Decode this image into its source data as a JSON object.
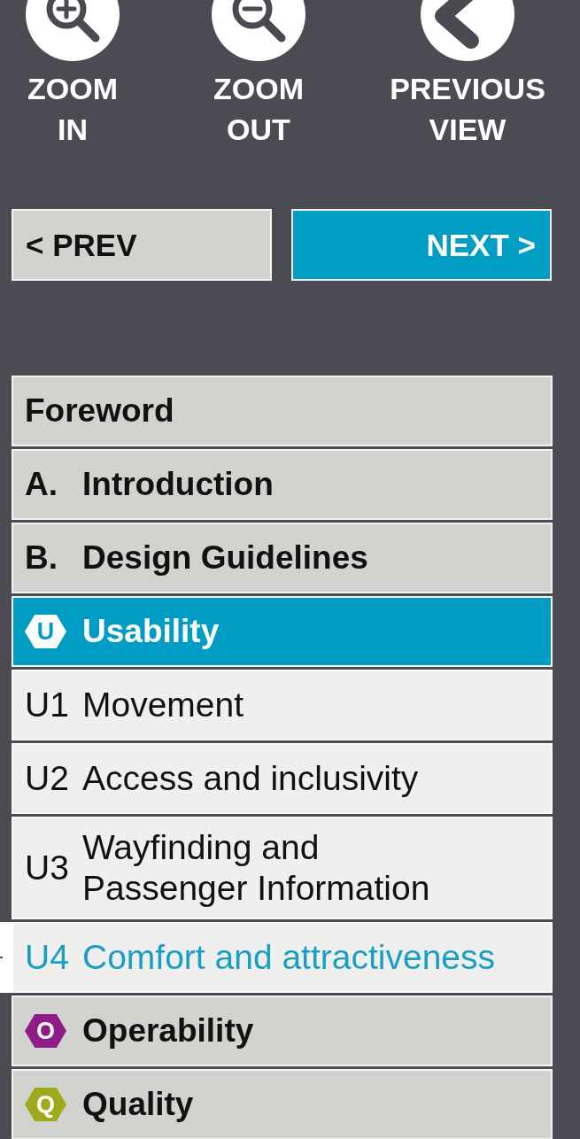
{
  "toolbar": [
    {
      "kind": "zoom_in",
      "label": "ZOOM IN"
    },
    {
      "kind": "zoom_out",
      "label": "ZOOM OUT"
    },
    {
      "kind": "previous_view",
      "label": "PREVIOUS VIEW"
    }
  ],
  "pager": [
    {
      "kind": "prev",
      "label": "< PREV"
    },
    {
      "kind": "next",
      "label": "NEXT >"
    }
  ],
  "nav": [
    {
      "kind": "section",
      "title": "Foreword"
    },
    {
      "kind": "section",
      "number": "A.",
      "title": "Introduction"
    },
    {
      "kind": "section",
      "number": "B.",
      "title": "Design Guidelines"
    },
    {
      "kind": "chapter",
      "letter": "U",
      "title": "Usability",
      "color": "#009cc3",
      "expanded": true,
      "children": [
        {
          "number": "U1",
          "title": "Movement",
          "selected": false
        },
        {
          "number": "U2",
          "title": "Access and inclusivity",
          "selected": false
        },
        {
          "number": "U3",
          "title": "Wayfinding and\nPassenger Information",
          "selected": false
        },
        {
          "number": "U4",
          "title": "Comfort and attractiveness",
          "selected": true
        }
      ]
    },
    {
      "kind": "chapter",
      "letter": "O",
      "title": "Operability",
      "color": "#8e1b88",
      "expanded": false
    },
    {
      "kind": "chapter",
      "letter": "Q",
      "title": "Quality",
      "color": "#a0a91b",
      "expanded": false
    }
  ]
}
